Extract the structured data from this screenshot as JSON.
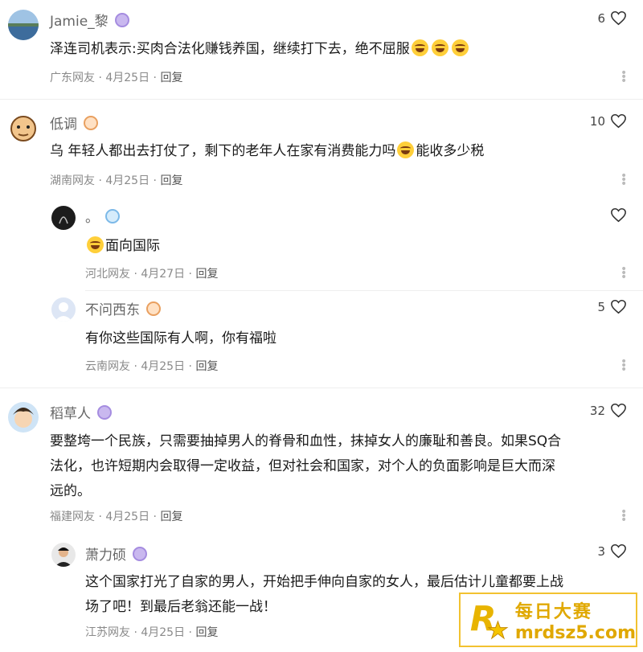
{
  "comments": [
    {
      "author": "Jamie_黎",
      "text": "泽连司机表示:买肉合法化赚钱养国，继续打下去，绝不屈服",
      "region": "广东网友",
      "date": "4月25日",
      "reply": "回复",
      "likes": "6"
    },
    {
      "author": "低调",
      "text_a": "乌 年轻人都出去打仗了，剩下的老年人在家有消费能力吗",
      "text_b": "能收多少税",
      "region": "湖南网友",
      "date": "4月25日",
      "reply": "回复",
      "likes": "10"
    },
    {
      "author": "。",
      "text": "面向国际",
      "region": "河北网友",
      "date": "4月27日",
      "reply": "回复",
      "likes": ""
    },
    {
      "author": "不问西东",
      "text": "有你这些国际有人啊，你有福啦",
      "region": "云南网友",
      "date": "4月25日",
      "reply": "回复",
      "likes": "5"
    },
    {
      "author": "稻草人",
      "text_line1": "要整垮一个民族，只需要抽掉男人的脊骨和血性，抹掉女人的廉耻和善良。如果SQ合",
      "text_line2": "法化，也许短期内会取得一定收益，但对社会和国家，对个人的负面影响是巨大而深",
      "text_line3": "远的。",
      "region": "福建网友",
      "date": "4月25日",
      "reply": "回复",
      "likes": "32"
    },
    {
      "author": "萧力硕",
      "text_line1": "这个国家打光了自家的男人，开始把手伸向自家的女人，最后估计儿童都要上战",
      "text_line2": "场了吧！到最后老翁还能一战！",
      "region": "江苏网友",
      "date": "4月25日",
      "reply": "回复",
      "likes": "3"
    }
  ],
  "separator": "·",
  "watermark": {
    "top": "每日大赛",
    "bottom": "mrdsz5.com"
  },
  "colors": {
    "brand_gold": "#e0a800",
    "meta_gray": "#8a8a8a"
  }
}
